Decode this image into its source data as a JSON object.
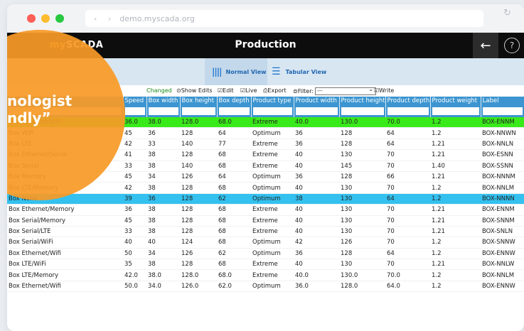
{
  "browser": {
    "url": "demo.myscada.org",
    "nav_arrows": "‹ ›",
    "reload_icon": "↻"
  },
  "app": {
    "logo_prefix": "my",
    "logo_main": "SCADA",
    "title": "Production",
    "back_icon": "←",
    "help_icon": "?"
  },
  "views": {
    "normal_label": "Normal View",
    "normal_icon": "||||",
    "tabular_label": "Tabular View",
    "tabular_icon": "☰"
  },
  "toolbar": {
    "changed_label": "Changed",
    "show_edits_label": "Show Edits",
    "show_edits_icon": "👁",
    "edit_label": "Edit",
    "live_label": "Live",
    "export_label": "Export",
    "filter_label": "Filter:",
    "filter_value": "---",
    "write_label": "Write",
    "checkbox_icon": "☑",
    "export_icon": "⎙",
    "filter_icon": "⊜"
  },
  "overlay": {
    "line1": "nologist",
    "line2": "ndly”",
    "color": "#f79a27"
  },
  "table": {
    "columns": [
      "",
      "Speed",
      "Box width",
      "Box height",
      "Box depth",
      "Product type",
      "Product width",
      "Product height",
      "Product depth",
      "Product weight",
      "Label"
    ],
    "rows": [
      [
        "Box Ethernet/WiFi",
        "36.0",
        "38.0",
        "128.0",
        "68.0",
        "Extreme",
        "40.0",
        "130.0",
        "70.0",
        "1.2",
        "BOX-ENNM"
      ],
      [
        "Box WiFi",
        "45",
        "36",
        "128",
        "64",
        "Optimum",
        "36",
        "128",
        "64",
        "1.2",
        "BOX-NNWN"
      ],
      [
        "Box LTE",
        "42",
        "33",
        "140",
        "77",
        "Extreme",
        "36",
        "128",
        "64",
        "1.21",
        "BOX-NNLN"
      ],
      [
        "Box Ethernet/Serial",
        "41",
        "38",
        "128",
        "68",
        "Extreme",
        "40",
        "130",
        "70",
        "1.21",
        "BOX-ESNN"
      ],
      [
        "Box Serial",
        "33",
        "38",
        "140",
        "68",
        "Extreme",
        "40",
        "145",
        "70",
        "1.40",
        "BOX-SSNN"
      ],
      [
        "Box Memory",
        "45",
        "34",
        "126",
        "64",
        "Optimum",
        "36",
        "128",
        "66",
        "1.21",
        "BOX-NNNM"
      ],
      [
        "Box LTE/Memory",
        "42",
        "38",
        "128",
        "68",
        "Optimum",
        "40",
        "130",
        "70",
        "1.2",
        "BOX-NNLM"
      ],
      [
        "Box None",
        "39",
        "36",
        "128",
        "62",
        "Optimum",
        "38",
        "130",
        "64",
        "1.2",
        "BOX-NNNN"
      ],
      [
        "Box Ethernet/Memory",
        "36",
        "38",
        "128",
        "68",
        "Extreme",
        "40",
        "130",
        "70",
        "1.21",
        "BOX-ENNM"
      ],
      [
        "Box Serial/Memory",
        "45",
        "38",
        "128",
        "68",
        "Extreme",
        "40",
        "130",
        "70",
        "1.21",
        "BOX-SNNM"
      ],
      [
        "Box Serial/LTE",
        "33",
        "38",
        "128",
        "68",
        "Extreme",
        "40",
        "130",
        "70",
        "1.21",
        "BOX-SNLN"
      ],
      [
        "Box Serial/WiFi",
        "40",
        "40",
        "124",
        "68",
        "Optimum",
        "42",
        "126",
        "70",
        "1.2",
        "BOX-SNNW"
      ],
      [
        "Box Ethernet/Wifi",
        "50",
        "34",
        "126",
        "62",
        "Optimum",
        "36",
        "128",
        "64",
        "1.2",
        "BOX-ENNW"
      ],
      [
        "Box LTE/WiFi",
        "35",
        "38",
        "128",
        "68",
        "Extreme",
        "40",
        "130",
        "70",
        "1.21",
        "BOX-NNLW"
      ],
      [
        "Box LTE/Memory",
        "42.0",
        "38.0",
        "128.0",
        "68.0",
        "Extreme",
        "40.0",
        "130.0",
        "70.0",
        "1.2",
        "BOX-NNLM"
      ],
      [
        "Box Ethernet/Wifi",
        "50.0",
        "34.0",
        "126.0",
        "62.0",
        "Optimum",
        "36.0",
        "128.0",
        "64.0",
        "1.2",
        "BOX-ENNW"
      ]
    ],
    "highlight_green_row": 0,
    "highlight_blue_row": 7,
    "green_color": "#39ea1a",
    "blue_color": "#34c1ef",
    "header_color": "#3c95d0"
  }
}
